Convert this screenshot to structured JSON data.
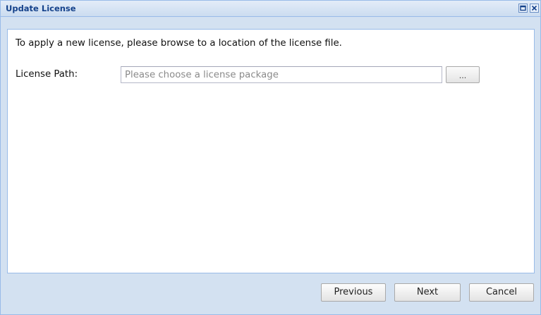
{
  "window": {
    "title": "Update License",
    "maximize_icon": "maximize-icon",
    "close_icon": "close-icon"
  },
  "panel": {
    "intro_text": "To apply a new license, please browse to a location of the license file.",
    "license_path": {
      "label": "License Path:",
      "value": "",
      "placeholder": "Please choose a license package",
      "browse_label": "..."
    }
  },
  "footer": {
    "previous_label": "Previous",
    "next_label": "Next",
    "cancel_label": "Cancel"
  },
  "colors": {
    "title_text": "#15428b",
    "border": "#99bbe8",
    "window_bg": "#d3e1f1"
  }
}
